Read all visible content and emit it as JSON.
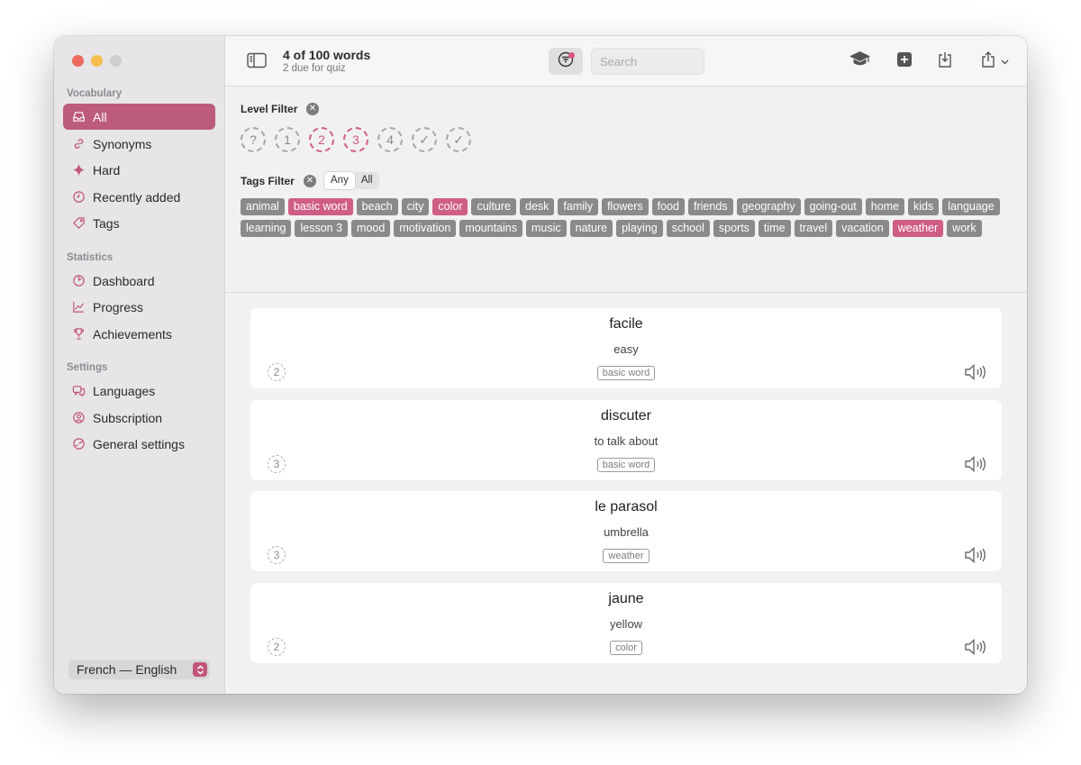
{
  "toolbar": {
    "title": "4 of 100 words",
    "subtitle": "2 due for quiz",
    "search_placeholder": "Search"
  },
  "sidebar": {
    "sections": {
      "vocabulary": "Vocabulary",
      "statistics": "Statistics",
      "settings": "Settings"
    },
    "items": [
      {
        "label": "All",
        "icon": "tray-icon",
        "active": true
      },
      {
        "label": "Synonyms",
        "icon": "link-icon"
      },
      {
        "label": "Hard",
        "icon": "sparkle-icon"
      },
      {
        "label": "Recently added",
        "icon": "clock-icon"
      },
      {
        "label": "Tags",
        "icon": "tag-icon"
      },
      {
        "label": "Dashboard",
        "icon": "gauge-icon"
      },
      {
        "label": "Progress",
        "icon": "chart-line-icon"
      },
      {
        "label": "Achievements",
        "icon": "trophy-icon"
      },
      {
        "label": "Languages",
        "icon": "speech-bubbles-icon"
      },
      {
        "label": "Subscription",
        "icon": "person-circle-icon"
      },
      {
        "label": "General settings",
        "icon": "settings-dial-icon"
      }
    ],
    "language_pair": "French — English"
  },
  "filters": {
    "level_label": "Level Filter",
    "levels": [
      {
        "label": "?",
        "selected": false
      },
      {
        "label": "1",
        "selected": false
      },
      {
        "label": "2",
        "selected": true
      },
      {
        "label": "3",
        "selected": true
      },
      {
        "label": "4",
        "selected": false
      },
      {
        "label": "✓",
        "selected": false
      },
      {
        "label": "✓",
        "selected": false
      }
    ],
    "tags_label": "Tags Filter",
    "match_mode": {
      "any": "Any",
      "all": "All",
      "selected": "any"
    },
    "tags": [
      {
        "label": "animal"
      },
      {
        "label": "basic word",
        "selected": true
      },
      {
        "label": "beach"
      },
      {
        "label": "city"
      },
      {
        "label": "color",
        "selected": true
      },
      {
        "label": "culture"
      },
      {
        "label": "desk"
      },
      {
        "label": "family"
      },
      {
        "label": "flowers"
      },
      {
        "label": "food"
      },
      {
        "label": "friends"
      },
      {
        "label": "geography"
      },
      {
        "label": "going-out"
      },
      {
        "label": "home"
      },
      {
        "label": "kids"
      },
      {
        "label": "language"
      },
      {
        "label": "learning"
      },
      {
        "label": "lesson 3"
      },
      {
        "label": "mood"
      },
      {
        "label": "motivation"
      },
      {
        "label": "mountains"
      },
      {
        "label": "music"
      },
      {
        "label": "nature"
      },
      {
        "label": "playing"
      },
      {
        "label": "school"
      },
      {
        "label": "sports"
      },
      {
        "label": "time"
      },
      {
        "label": "travel"
      },
      {
        "label": "vacation"
      },
      {
        "label": "weather",
        "selected": true
      },
      {
        "label": "work"
      }
    ]
  },
  "words": [
    {
      "word": "facile",
      "translation": "easy",
      "tag": "basic word",
      "level": "2"
    },
    {
      "word": "discuter",
      "translation": "to talk about",
      "tag": "basic word",
      "level": "3"
    },
    {
      "word": "le parasol",
      "translation": "umbrella",
      "tag": "weather",
      "level": "3"
    },
    {
      "word": "jaune",
      "translation": "yellow",
      "tag": "color",
      "level": "2"
    }
  ],
  "colors": {
    "accent": "#bd5b7d",
    "tag_selected": "#cf5d86",
    "tag_default": "#8a898c"
  }
}
